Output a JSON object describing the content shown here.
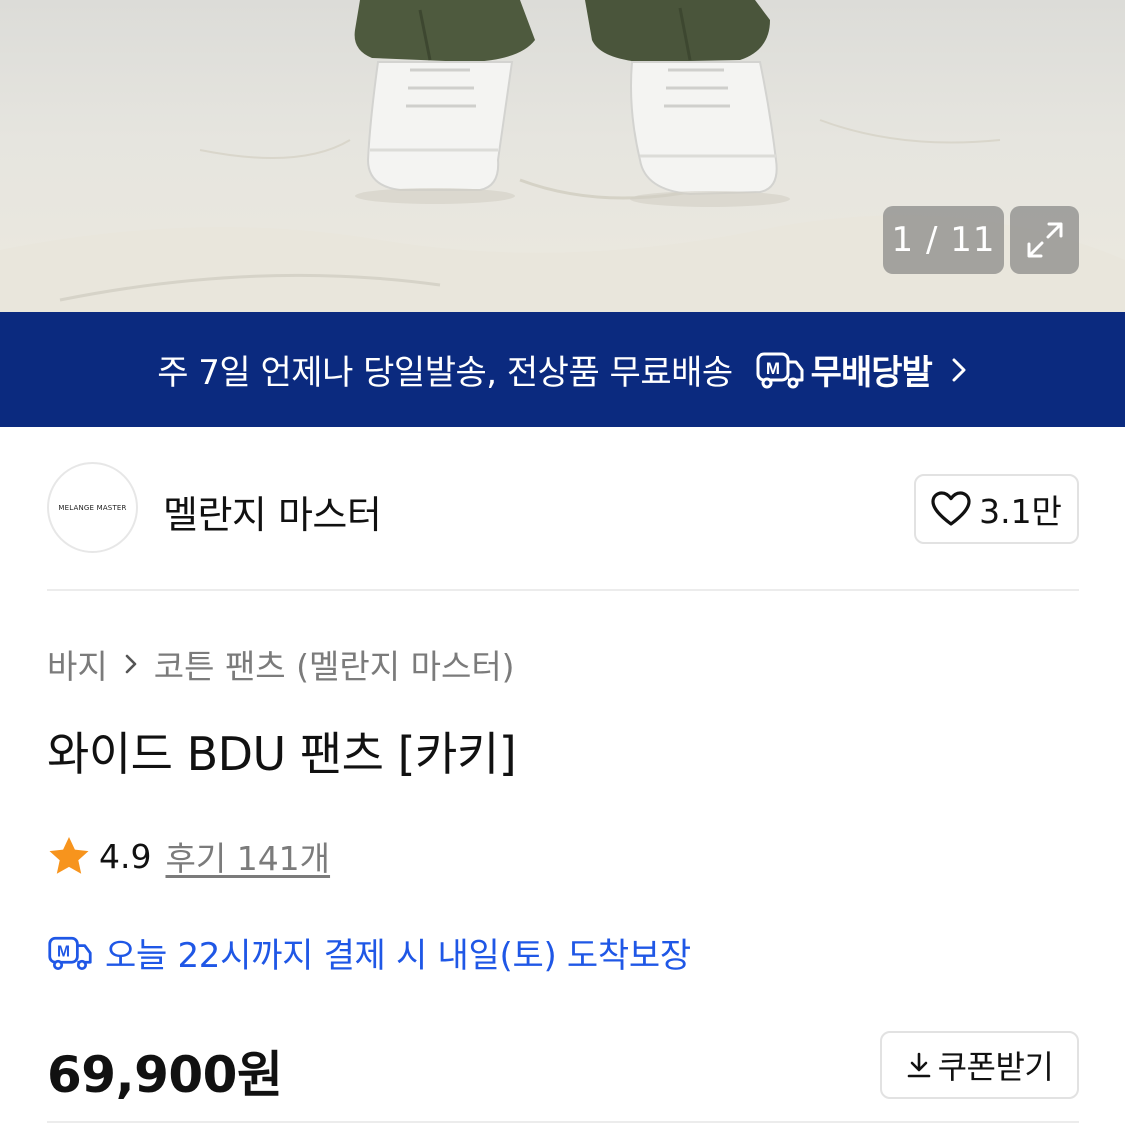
{
  "gallery": {
    "counter": "1 / 11",
    "icons": {
      "expand": "expand-arrows-icon"
    }
  },
  "promo_banner": {
    "text": "주 7일 언제나 당일발송, 전상품 무료배송",
    "brand": "무배당발",
    "logo_letter": "M",
    "background": "#0b2a7f",
    "icons": {
      "logo": "delivery-truck-m-icon",
      "arrow": "chevron-right-icon"
    }
  },
  "store": {
    "logo_text": "MELANGE MASTER",
    "name": "멜란지 마스터",
    "like_count": "3.1만",
    "icons": {
      "like": "heart-outline-icon"
    }
  },
  "product": {
    "breadcrumb": [
      "바지",
      "코튼 팬츠 (멜란지 마스터)"
    ],
    "title": "와이드 BDU 팬츠 [카키]",
    "rating": "4.9",
    "reviews": "후기 141개",
    "delivery_text": "오늘 22시까지 결제 시 내일(토) 도착보장",
    "price": "69,900원",
    "coupon_label": "쿠폰받기",
    "colors": {
      "delivery": "#1f57e6",
      "star": "#f7941d"
    },
    "icons": {
      "star": "star-filled-icon",
      "delivery": "delivery-truck-m-icon",
      "download": "download-icon",
      "breadcrumb_sep": "chevron-right-icon"
    }
  }
}
